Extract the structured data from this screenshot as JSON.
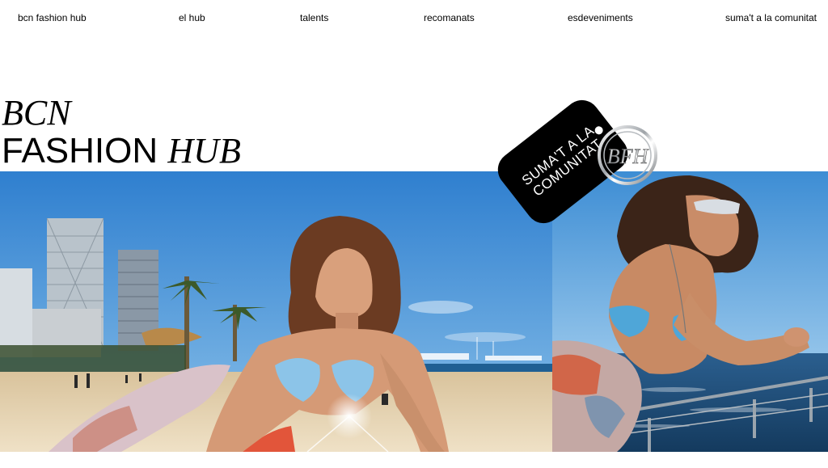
{
  "nav": {
    "brand": "bcn fashion hub",
    "items": [
      "el hub",
      "talents",
      "recomanats",
      "esdeveniments",
      "suma't a la comunitat"
    ]
  },
  "hero": {
    "title_line1": "BCN",
    "title_line2_a": "FASHION",
    "title_line2_b": "HUB"
  },
  "tag": {
    "label": "SUMA'T A LA COMUNITAT"
  },
  "emblem": {
    "icon": "bfh-chrome-logo-icon",
    "letters": "BFH"
  },
  "images": {
    "left": "beach-model-photo",
    "right": "seaside-model-photo"
  },
  "colors": {
    "background": "#ffffff",
    "text": "#000000",
    "sky": "#3f8fd6",
    "sea": "#1e4f7a",
    "sand": "#e6d2b0"
  }
}
